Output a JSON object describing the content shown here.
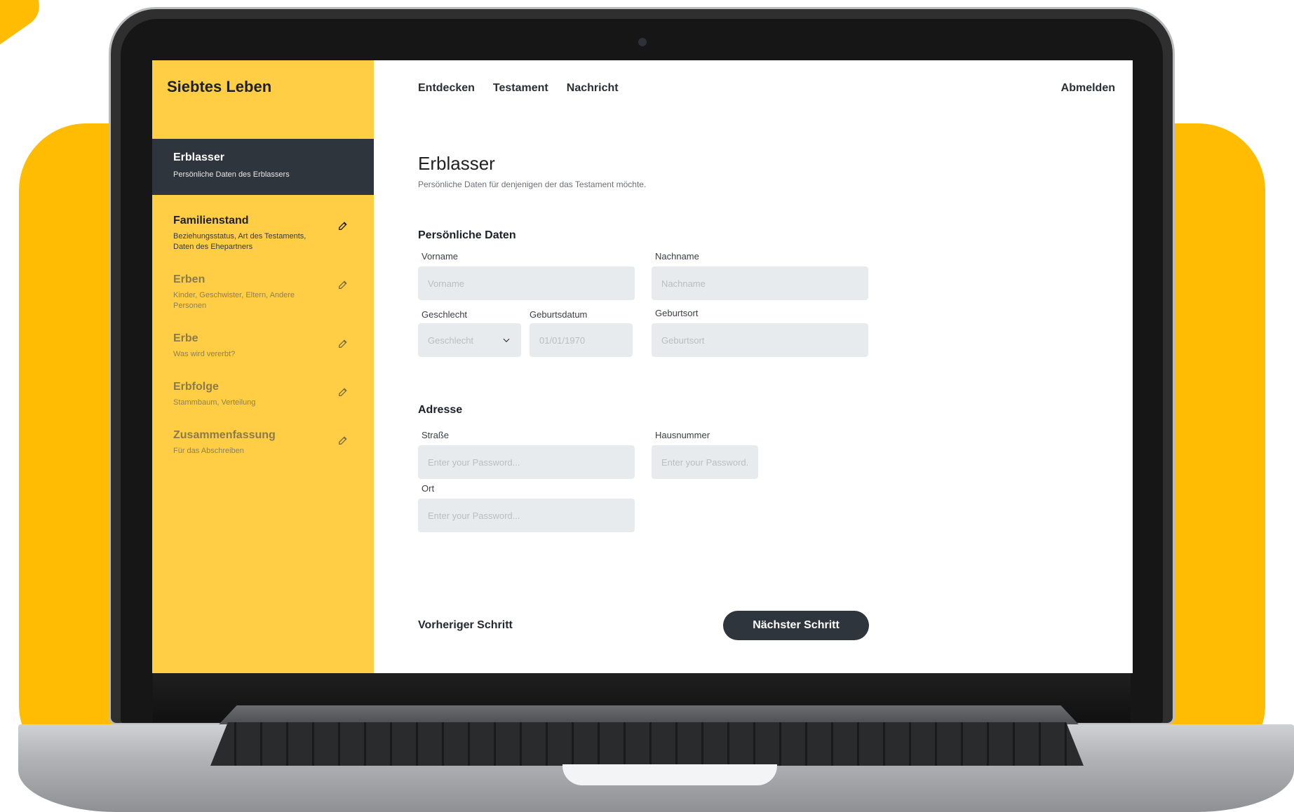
{
  "app": {
    "brand": "Siebtes Leben"
  },
  "nav": {
    "items": [
      "Entdecken",
      "Testament",
      "Nachricht"
    ],
    "logout": "Abmelden"
  },
  "sidebar": {
    "active": {
      "title": "Erblasser",
      "subtitle": "Persönliche Daten des Erblassers"
    },
    "steps": [
      {
        "title": "Familienstand",
        "subtitle": "Beziehungsstatus, Art des Testaments, Daten des Ehepartners"
      },
      {
        "title": "Erben",
        "subtitle": "Kinder, Geschwister, Eltern, Andere Personen"
      },
      {
        "title": "Erbe",
        "subtitle": "Was wird vererbt?"
      },
      {
        "title": "Erbfolge",
        "subtitle": "Stammbaum, Verteilung"
      },
      {
        "title": "Zusammenfassung",
        "subtitle": "Für das Abschreiben"
      }
    ]
  },
  "page": {
    "title": "Erblasser",
    "subtitle": "Persönliche Daten für denjenigen der das Testament möchte."
  },
  "personal": {
    "heading": "Persönliche Daten",
    "vorname": {
      "label": "Vorname",
      "placeholder": "Vorname"
    },
    "nachname": {
      "label": "Nachname",
      "placeholder": "Nachname"
    },
    "geschlecht": {
      "label": "Geschlecht",
      "value": "Geschlecht"
    },
    "geburtsdatum": {
      "label": "Geburtsdatum",
      "placeholder": "01/01/1970"
    },
    "geburtsort": {
      "label": "Geburtsort",
      "placeholder": "Geburtsort"
    }
  },
  "address": {
    "heading": "Adresse",
    "strasse": {
      "label": "Straße",
      "placeholder": "Enter your Password..."
    },
    "hausnummer": {
      "label": "Hausnummer",
      "placeholder": "Enter your Password..."
    },
    "ort": {
      "label": "Ort",
      "placeholder": "Enter your Password..."
    }
  },
  "footer": {
    "prev": "Vorheriger Schritt",
    "next": "Nächster Schritt"
  },
  "colors": {
    "accent": "#ffbc03",
    "sidebar": "#ffce45",
    "dark": "#2f353c",
    "field": "#e8ebed"
  },
  "icons": {
    "edit": "edit-icon",
    "chevron": "chevron-down-icon"
  }
}
